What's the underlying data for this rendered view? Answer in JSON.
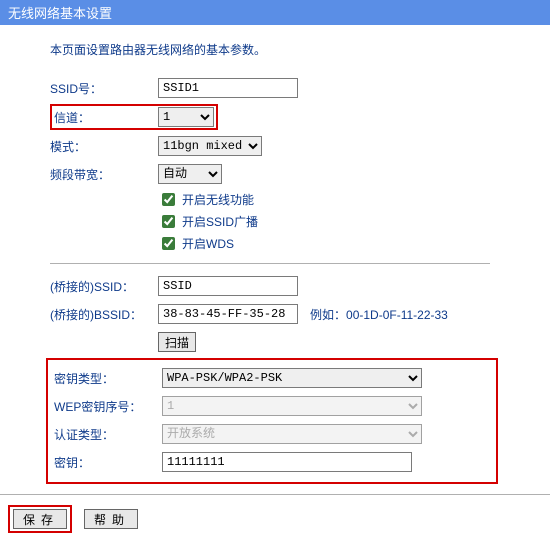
{
  "title": "无线网络基本设置",
  "intro": "本页面设置路由器无线网络的基本参数。",
  "labels": {
    "ssid": "SSID号：",
    "channel": "信道：",
    "mode": "模式：",
    "bandwidth": "频段带宽：",
    "bridge_ssid": "(桥接的)SSID：",
    "bridge_bssid": "(桥接的)BSSID：",
    "example_prefix": "例如：",
    "key_type": "密钥类型：",
    "wep_index": "WEP密钥序号：",
    "auth_type": "认证类型：",
    "key": "密钥："
  },
  "values": {
    "ssid": "SSID1",
    "channel": "1",
    "mode": "11bgn mixed",
    "bandwidth": "自动",
    "bridge_ssid": "SSID",
    "bridge_bssid": "38-83-45-FF-35-28",
    "example_bssid": "00-1D-0F-11-22-33",
    "key_type": "WPA-PSK/WPA2-PSK",
    "wep_index": "1",
    "auth_type": "开放系统",
    "key": "11111111"
  },
  "checkboxes": {
    "enable_wireless": "开启无线功能",
    "enable_ssid_broadcast": "开启SSID广播",
    "enable_wds": "开启WDS"
  },
  "buttons": {
    "scan": "扫描",
    "save": "保存",
    "help": "帮助"
  }
}
